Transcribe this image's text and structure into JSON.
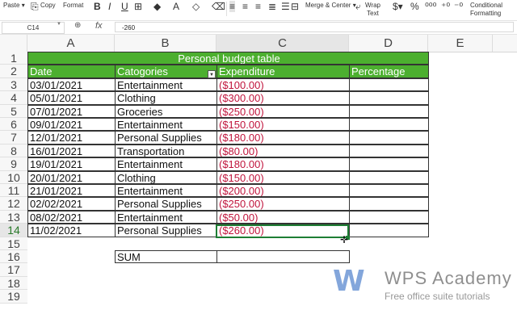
{
  "toolbar": {
    "paste": "Paste",
    "copy": "Copy",
    "format": "Format",
    "merge_center": "Merge & Center",
    "wrap_text_1": "Wrap",
    "wrap_text_2": "Text",
    "conditional_1": "Conditional",
    "conditional_2": "Formatting"
  },
  "formula_bar": {
    "cell_ref": "C14",
    "fx": "fx",
    "value": "-260"
  },
  "columns": [
    "A",
    "B",
    "C",
    "D",
    "E"
  ],
  "rows": [
    "1",
    "2",
    "3",
    "4",
    "5",
    "6",
    "7",
    "8",
    "9",
    "10",
    "11",
    "12",
    "13",
    "14",
    "15",
    "16",
    "17",
    "18",
    "19"
  ],
  "table": {
    "title": "Personal budget table",
    "headers": {
      "date": "Date",
      "categories": "Catogories",
      "expenditure": "Expenditure",
      "percentage": "Percentage"
    },
    "records": [
      {
        "date": "03/01/2021",
        "category": "Entertainment",
        "amount": "($100.00)"
      },
      {
        "date": "05/01/2021",
        "category": "Clothing",
        "amount": "($300.00)"
      },
      {
        "date": "07/01/2021",
        "category": "Groceries",
        "amount": "($250.00)"
      },
      {
        "date": "09/01/2021",
        "category": "Entertainment",
        "amount": "($150.00)"
      },
      {
        "date": "12/01/2021",
        "category": "Personal Supplies",
        "amount": "($180.00)"
      },
      {
        "date": "16/01/2021",
        "category": "Transportation",
        "amount": "($80.00)"
      },
      {
        "date": "19/01/2021",
        "category": "Entertainment",
        "amount": "($180.00)"
      },
      {
        "date": "20/01/2021",
        "category": "Clothing",
        "amount": "($150.00)"
      },
      {
        "date": "21/01/2021",
        "category": "Entertainment",
        "amount": "($200.00)"
      },
      {
        "date": "02/02/2021",
        "category": "Personal Supplies",
        "amount": "($250.00)"
      },
      {
        "date": "08/02/2021",
        "category": "Entertainment",
        "amount": "($50.00)"
      },
      {
        "date": "11/02/2021",
        "category": "Personal Supplies",
        "amount": "($260.00)"
      }
    ],
    "sum_label": "SUM"
  },
  "watermark": {
    "title": "WPS Academy",
    "subtitle": "Free office suite tutorials"
  },
  "colors": {
    "header_green": "#4caf2f",
    "negative_red": "#c0143c",
    "selection_green": "#1e7e34"
  }
}
